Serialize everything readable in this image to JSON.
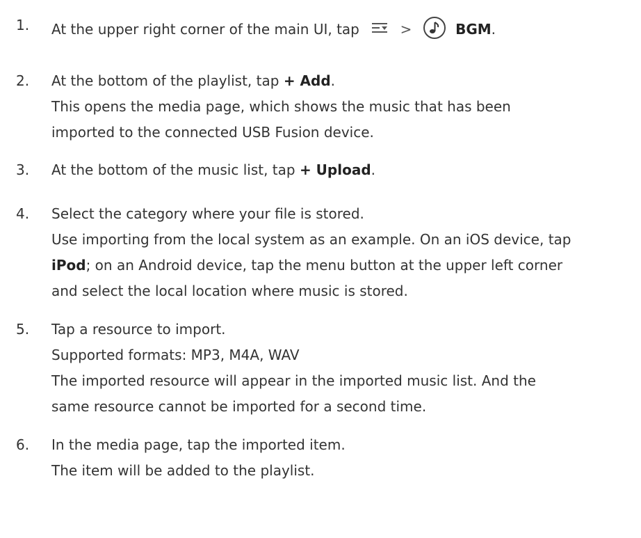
{
  "steps": [
    {
      "number": "1.",
      "text_before": "At the upper right corner of the main UI, tap",
      "icon1": "menu-dropdown-icon",
      "separator": ">",
      "icon2": "music-note-icon",
      "bold": "BGM",
      "end": "."
    },
    {
      "number": "2.",
      "text_before": "At the bottom of the playlist, tap ",
      "bold": "+ Add",
      "end": ".",
      "lines": [
        "This opens the media page, which shows the music that has been",
        "imported to the connected USB Fusion device."
      ]
    },
    {
      "number": "3.",
      "text_before": "At the bottom of the music list, tap ",
      "bold": "+ Upload",
      "end": "."
    },
    {
      "number": "4.",
      "text": "Select the category where your file is stored.",
      "lines": [
        "Use importing from the local system as an example. On an iOS device, tap"
      ],
      "bold_line_start": "iPod",
      "bold_line_rest": "; on an Android device, tap the menu button at the upper left corner",
      "last_line": "and select the local location where music is stored."
    },
    {
      "number": "5.",
      "text": "Tap a resource to import.",
      "lines": [
        "Supported formats: MP3, M4A, WAV",
        "The imported resource will appear in the imported music list. And the",
        "same resource cannot be imported for a second time."
      ]
    },
    {
      "number": "6.",
      "text": "In the media page, tap the imported item.",
      "lines": [
        "The item will be added to the playlist."
      ]
    }
  ]
}
